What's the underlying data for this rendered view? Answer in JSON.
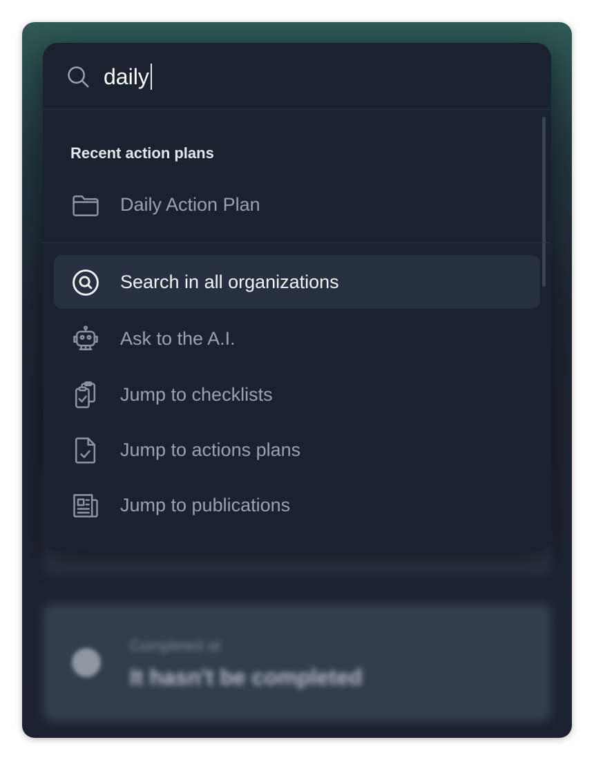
{
  "search": {
    "value": "daily",
    "placeholder": ""
  },
  "recent": {
    "title": "Recent action plans",
    "items": [
      {
        "label": "Daily Action Plan",
        "icon": "folder-icon"
      }
    ]
  },
  "actions": [
    {
      "label": "Search in all organizations",
      "icon": "search-circle-icon",
      "highlighted": true
    },
    {
      "label": "Ask to the A.I.",
      "icon": "robot-icon",
      "highlighted": false
    },
    {
      "label": "Jump to checklists",
      "icon": "clipboard-check-icon",
      "highlighted": false
    },
    {
      "label": "Jump to actions plans",
      "icon": "file-check-icon",
      "highlighted": false
    },
    {
      "label": "Jump to publications",
      "icon": "newspaper-icon",
      "highlighted": false
    }
  ],
  "background": {
    "card_subtitle": "Completed at",
    "card_title": "It hasn't be completed"
  },
  "colors": {
    "palette_bg": "#1a2230",
    "highlight_bg": "#263040",
    "text_primary": "#f2f4f7",
    "text_muted": "#9aa2ae"
  }
}
